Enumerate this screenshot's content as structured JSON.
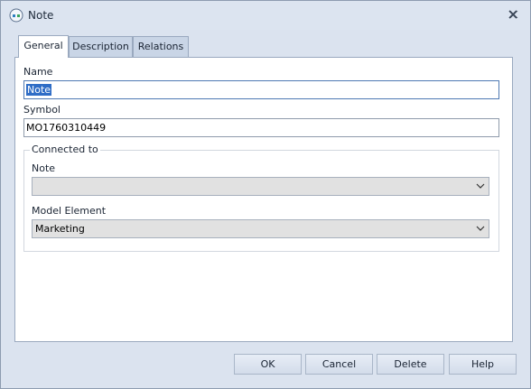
{
  "window": {
    "title": "Note",
    "icon": "note-app-icon",
    "close_icon": "close-icon"
  },
  "tabs": [
    {
      "label": "General",
      "active": true
    },
    {
      "label": "Description",
      "active": false
    },
    {
      "label": "Relations",
      "active": false
    }
  ],
  "general": {
    "name_label": "Name",
    "name_value": "Note",
    "symbol_label": "Symbol",
    "symbol_value": "MO1760310449",
    "connected_group_label": "Connected to",
    "note_label": "Note",
    "note_value": "",
    "model_element_label": "Model Element",
    "model_element_value": "Marketing"
  },
  "buttons": {
    "ok": "OK",
    "cancel": "Cancel",
    "delete": "Delete",
    "help": "Help"
  },
  "colors": {
    "accent": "#2f6dc6",
    "window_bg": "#dbe3ef",
    "panel_bg": "#ffffff"
  }
}
